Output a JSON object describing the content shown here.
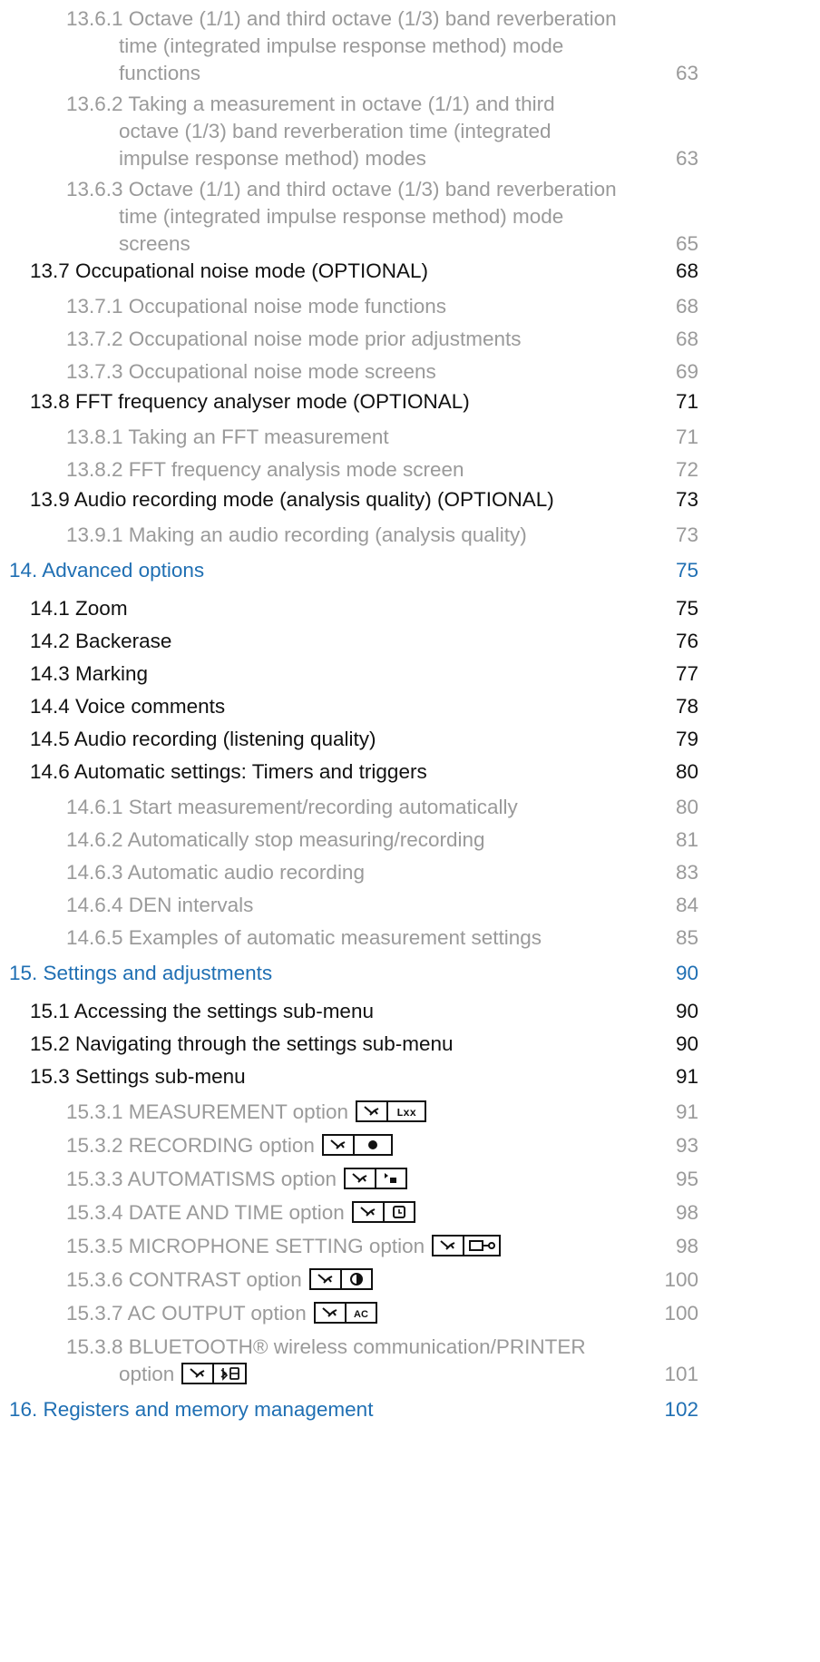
{
  "entries": [
    {
      "level": 3,
      "lines": [
        "13.6.1 Octave (1/1) and third octave (1/3) band reverberation",
        "time (integrated impulse response method) mode",
        "functions"
      ],
      "page": "63"
    },
    {
      "level": 3,
      "lines": [
        "13.6.2 Taking a measurement in octave (1/1) and third",
        "octave (1/3) band reverberation time (integrated",
        "impulse response method) modes"
      ],
      "page": "63"
    },
    {
      "level": 3,
      "lines": [
        "13.6.3 Octave (1/1) and third octave (1/3) band reverberation",
        "time (integrated impulse response method) mode",
        "screens"
      ],
      "page": "65"
    },
    {
      "level": 2,
      "lines": [
        "13.7 Occupational noise mode (OPTIONAL)"
      ],
      "page": "68"
    },
    {
      "level": 3,
      "lines": [
        "13.7.1 Occupational noise mode functions"
      ],
      "page": "68"
    },
    {
      "level": 3,
      "lines": [
        "13.7.2 Occupational noise mode prior adjustments"
      ],
      "page": "68"
    },
    {
      "level": 3,
      "lines": [
        "13.7.3 Occupational noise mode screens"
      ],
      "page": "69"
    },
    {
      "level": 2,
      "lines": [
        "13.8 FFT frequency analyser mode (OPTIONAL)"
      ],
      "page": "71"
    },
    {
      "level": 3,
      "lines": [
        "13.8.1 Taking an FFT measurement"
      ],
      "page": "71"
    },
    {
      "level": 3,
      "lines": [
        "13.8.2 FFT frequency analysis mode screen"
      ],
      "page": "72"
    },
    {
      "level": 2,
      "lines": [
        "13.9 Audio recording mode (analysis quality) (OPTIONAL)"
      ],
      "page": "73"
    },
    {
      "level": 3,
      "lines": [
        "13.9.1 Making an audio recording (analysis quality)"
      ],
      "page": "73"
    },
    {
      "level": 1,
      "lines": [
        "14. Advanced options"
      ],
      "page": "75"
    },
    {
      "level": 2,
      "lines": [
        "14.1 Zoom"
      ],
      "page": "75"
    },
    {
      "level": 2,
      "lines": [
        "14.2 Backerase"
      ],
      "page": "76"
    },
    {
      "level": 2,
      "lines": [
        "14.3 Marking"
      ],
      "page": "77"
    },
    {
      "level": 2,
      "lines": [
        "14.4 Voice comments"
      ],
      "page": "78"
    },
    {
      "level": 2,
      "lines": [
        "14.5 Audio recording (listening quality)"
      ],
      "page": "79"
    },
    {
      "level": 2,
      "lines": [
        "14.6 Automatic settings: Timers and triggers"
      ],
      "page": "80"
    },
    {
      "level": 3,
      "lines": [
        "14.6.1 Start measurement/recording automatically"
      ],
      "page": "80"
    },
    {
      "level": 3,
      "lines": [
        "14.6.2 Automatically stop measuring/recording"
      ],
      "page": "81"
    },
    {
      "level": 3,
      "lines": [
        "14.6.3 Automatic audio recording"
      ],
      "page": "83"
    },
    {
      "level": 3,
      "lines": [
        "14.6.4 DEN intervals"
      ],
      "page": "84"
    },
    {
      "level": 3,
      "lines": [
        "14.6.5 Examples of automatic measurement settings"
      ],
      "page": "85"
    },
    {
      "level": 1,
      "lines": [
        "15. Settings and adjustments"
      ],
      "page": "90"
    },
    {
      "level": 2,
      "lines": [
        "15.1 Accessing the settings sub-menu"
      ],
      "page": "90"
    },
    {
      "level": 2,
      "lines": [
        "15.2 Navigating through the settings sub-menu"
      ],
      "page": "90"
    },
    {
      "level": 2,
      "lines": [
        "15.3 Settings sub-menu"
      ],
      "page": "91"
    },
    {
      "level": 3,
      "lines": [
        "15.3.1 MEASUREMENT option"
      ],
      "page": "91",
      "icon": "lxx"
    },
    {
      "level": 3,
      "lines": [
        "15.3.2 RECORDING option"
      ],
      "page": "93",
      "icon": "dot"
    },
    {
      "level": 3,
      "lines": [
        "15.3.3 AUTOMATISMS option"
      ],
      "page": "95",
      "icon": "play-stop"
    },
    {
      "level": 3,
      "lines": [
        "15.3.4 DATE AND TIME option"
      ],
      "page": "98",
      "icon": "clock"
    },
    {
      "level": 3,
      "lines": [
        "15.3.5 MICROPHONE SETTING option"
      ],
      "page": "98",
      "icon": "mic"
    },
    {
      "level": 3,
      "lines": [
        "15.3.6 CONTRAST option"
      ],
      "page": "100",
      "icon": "contrast"
    },
    {
      "level": 3,
      "lines": [
        "15.3.7 AC OUTPUT option"
      ],
      "page": "100",
      "icon": "ac"
    },
    {
      "level": 3,
      "lines": [
        "15.3.8 BLUETOOTH® wireless communication/PRINTER",
        "option"
      ],
      "page": "101",
      "icon": "bt-printer"
    },
    {
      "level": 1,
      "lines": [
        "16. Registers and memory management"
      ],
      "page": "102"
    }
  ]
}
